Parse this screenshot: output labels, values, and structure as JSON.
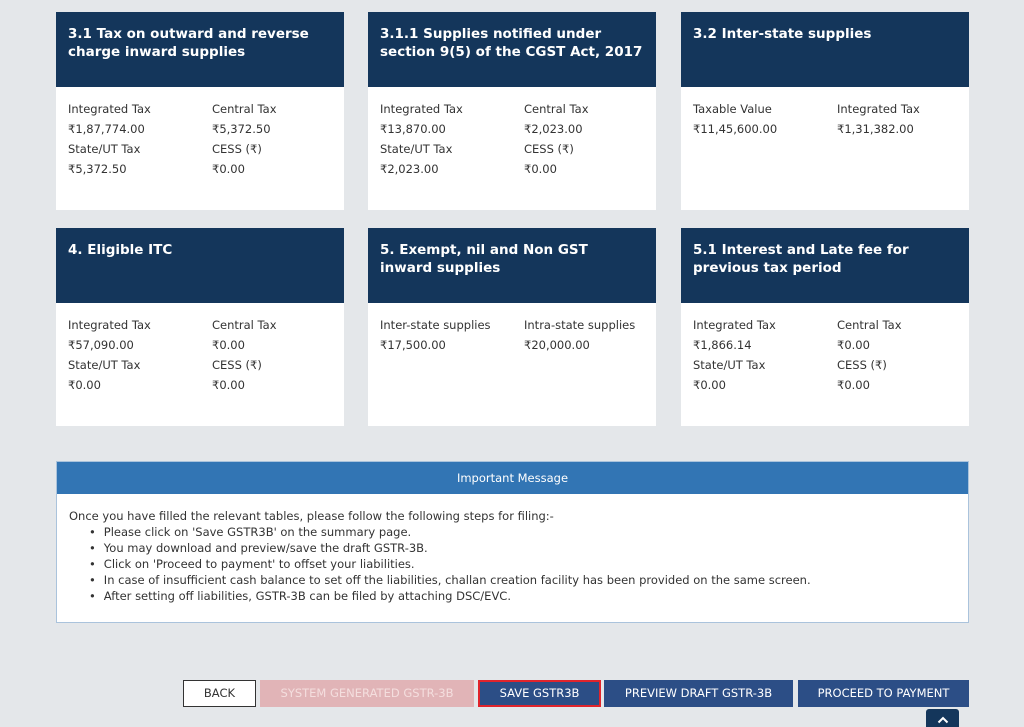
{
  "cards": [
    {
      "title": "3.1 Tax on outward and reverse charge inward supplies",
      "fields": [
        {
          "label": "Integrated Tax",
          "value": "₹1,87,774.00"
        },
        {
          "label": "Central Tax",
          "value": "₹5,372.50"
        },
        {
          "label": "State/UT Tax",
          "value": "₹5,372.50"
        },
        {
          "label": "CESS (₹)",
          "value": "₹0.00"
        }
      ]
    },
    {
      "title": "3.1.1 Supplies notified under section 9(5) of the CGST Act, 2017",
      "fields": [
        {
          "label": "Integrated Tax",
          "value": "₹13,870.00"
        },
        {
          "label": "Central Tax",
          "value": "₹2,023.00"
        },
        {
          "label": "State/UT Tax",
          "value": "₹2,023.00"
        },
        {
          "label": "CESS (₹)",
          "value": "₹0.00"
        }
      ]
    },
    {
      "title": "3.2 Inter-state supplies",
      "fields": [
        {
          "label": "Taxable Value",
          "value": "₹11,45,600.00"
        },
        {
          "label": "Integrated Tax",
          "value": "₹1,31,382.00"
        }
      ]
    },
    {
      "title": "4. Eligible ITC",
      "fields": [
        {
          "label": "Integrated Tax",
          "value": "₹57,090.00"
        },
        {
          "label": "Central Tax",
          "value": "₹0.00"
        },
        {
          "label": "State/UT Tax",
          "value": "₹0.00"
        },
        {
          "label": "CESS (₹)",
          "value": "₹0.00"
        }
      ]
    },
    {
      "title": "5. Exempt, nil and Non GST inward supplies",
      "fields": [
        {
          "label": "Inter-state supplies",
          "value": "₹17,500.00"
        },
        {
          "label": "Intra-state supplies",
          "value": "₹20,000.00"
        }
      ]
    },
    {
      "title": "5.1 Interest and Late fee for previous tax period",
      "fields": [
        {
          "label": "Integrated Tax",
          "value": "₹1,866.14"
        },
        {
          "label": "Central Tax",
          "value": "₹0.00"
        },
        {
          "label": "State/UT Tax",
          "value": "₹0.00"
        },
        {
          "label": "CESS (₹)",
          "value": "₹0.00"
        }
      ]
    }
  ],
  "message": {
    "title": "Important Message",
    "intro": "Once you have filled the relevant tables, please follow the following steps for filing:-",
    "steps": [
      "Please click on 'Save GSTR3B' on the summary page.",
      "You may download and preview/save the draft GSTR-3B.",
      "Click on 'Proceed to payment' to offset your liabilities.",
      "In case of insufficient cash balance to set off the liabilities, challan creation facility has been provided on the same screen.",
      "After setting off liabilities, GSTR-3B can be filed by attaching DSC/EVC."
    ]
  },
  "buttons": {
    "back": "BACK",
    "system_generated": "SYSTEM GENERATED GSTR-3B",
    "save": "SAVE GSTR3B",
    "preview": "PREVIEW DRAFT GSTR-3B",
    "proceed": "PROCEED TO PAYMENT"
  },
  "icons": {
    "scroll_top": "chevron-up-icon"
  }
}
